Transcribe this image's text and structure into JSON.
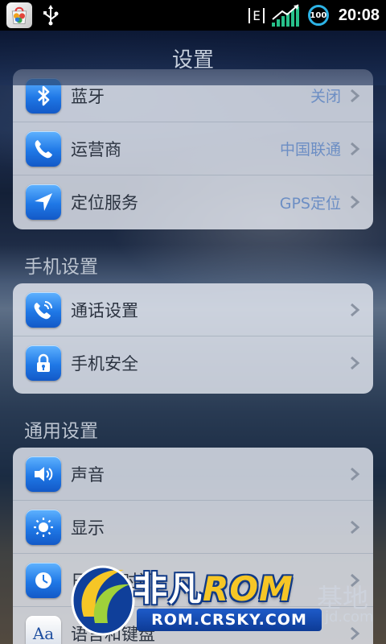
{
  "status_bar": {
    "network_type": "E",
    "battery_level": "100",
    "time": "20:08",
    "icons": [
      "app-store-icon",
      "usb-icon",
      "signal-strength-icon",
      "battery-icon"
    ]
  },
  "title": "设置",
  "groups": {
    "connections": {
      "items": [
        {
          "label": "蓝牙",
          "value": "关闭",
          "icon": "bluetooth-icon"
        },
        {
          "label": "运营商",
          "value": "中国联通",
          "icon": "phone-icon"
        },
        {
          "label": "定位服务",
          "value": "GPS定位",
          "icon": "location-icon"
        }
      ]
    },
    "phone_settings": {
      "header": "手机设置",
      "items": [
        {
          "label": "通话设置",
          "value": "",
          "icon": "call-settings-icon"
        },
        {
          "label": "手机安全",
          "value": "",
          "icon": "lock-icon"
        }
      ]
    },
    "general_settings": {
      "header": "通用设置",
      "items": [
        {
          "label": "声音",
          "value": "",
          "icon": "speaker-icon"
        },
        {
          "label": "显示",
          "value": "",
          "icon": "brightness-icon"
        },
        {
          "label": "日期和时间",
          "value": "",
          "icon": "clock-icon"
        },
        {
          "label": "语言和键盘",
          "value": "",
          "icon": "keyboard-icon"
        }
      ]
    }
  },
  "watermark": {
    "brand_cn": "非凡",
    "brand_rom": "ROM",
    "url": "ROM.CRSKY.COM",
    "tail_text": "基地",
    "tail_url": "jd.com"
  },
  "colors": {
    "icon_blue": "#1f78e6",
    "value_blue": "#6c8ec4",
    "battery_ring": "#2db3e6",
    "signal_green": "#27c08a"
  }
}
